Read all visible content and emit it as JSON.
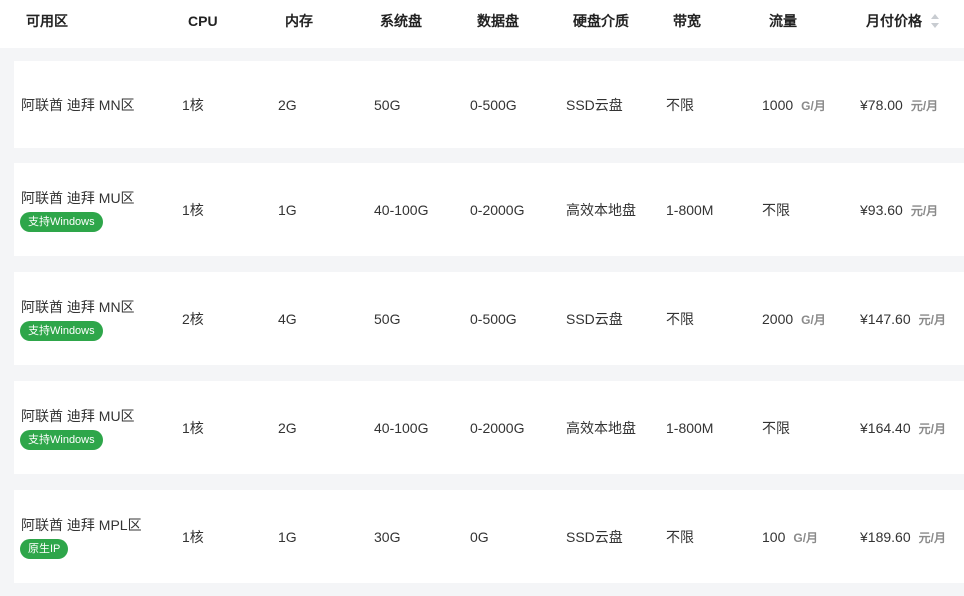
{
  "header": {
    "zone": "可用区",
    "cpu": "CPU",
    "memory": "内存",
    "system_disk": "系统盘",
    "data_disk": "数据盘",
    "disk_medium": "硬盘介质",
    "bandwidth": "带宽",
    "traffic": "流量",
    "monthly_price": "月付价格"
  },
  "rows": [
    {
      "zone": "阿联酋 迪拜 MN区",
      "badge": "",
      "cpu": "1核",
      "memory": "2G",
      "system_disk": "50G",
      "data_disk": "0-500G",
      "disk_medium": "SSD云盘",
      "bandwidth": "不限",
      "traffic": "1000",
      "traffic_unit": "G/月",
      "price": "¥78.00",
      "price_unit": "元/月"
    },
    {
      "zone": "阿联酋 迪拜 MU区",
      "badge": "支持Windows",
      "cpu": "1核",
      "memory": "1G",
      "system_disk": "40-100G",
      "data_disk": "0-2000G",
      "disk_medium": "高效本地盘",
      "bandwidth": "1-800M",
      "traffic": "不限",
      "traffic_unit": "",
      "price": "¥93.60",
      "price_unit": "元/月"
    },
    {
      "zone": "阿联酋 迪拜 MN区",
      "badge": "支持Windows",
      "cpu": "2核",
      "memory": "4G",
      "system_disk": "50G",
      "data_disk": "0-500G",
      "disk_medium": "SSD云盘",
      "bandwidth": "不限",
      "traffic": "2000",
      "traffic_unit": "G/月",
      "price": "¥147.60",
      "price_unit": "元/月"
    },
    {
      "zone": "阿联酋 迪拜 MU区",
      "badge": "支持Windows",
      "cpu": "1核",
      "memory": "2G",
      "system_disk": "40-100G",
      "data_disk": "0-2000G",
      "disk_medium": "高效本地盘",
      "bandwidth": "1-800M",
      "traffic": "不限",
      "traffic_unit": "",
      "price": "¥164.40",
      "price_unit": "元/月"
    },
    {
      "zone": "阿联酋 迪拜 MPL区",
      "badge": "原生IP",
      "cpu": "1核",
      "memory": "1G",
      "system_disk": "30G",
      "data_disk": "0G",
      "disk_medium": "SSD云盘",
      "bandwidth": "不限",
      "traffic": "100",
      "traffic_unit": "G/月",
      "price": "¥189.60",
      "price_unit": "元/月"
    }
  ],
  "colors": {
    "badge": "#2ea64a",
    "row_bg": "#ffffff",
    "page_bg": "#f4f5f7"
  },
  "icons": {
    "sort": "sort-icon"
  }
}
